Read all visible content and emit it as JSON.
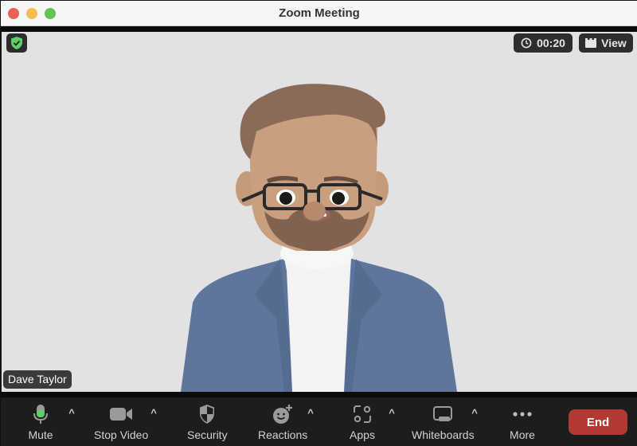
{
  "window": {
    "title": "Zoom Meeting"
  },
  "video": {
    "participant_name": "Dave Taylor",
    "timer": "00:20",
    "view_label": "View",
    "background_color": "#e2e2e5",
    "encryption_status": "secure"
  },
  "toolbar": {
    "items": [
      {
        "label": "Mute",
        "icon": "microphone-icon",
        "has_caret": true
      },
      {
        "label": "Stop Video",
        "icon": "video-camera-icon",
        "has_caret": true
      },
      {
        "label": "Security",
        "icon": "shield-icon",
        "has_caret": false
      },
      {
        "label": "Reactions",
        "icon": "smiley-plus-icon",
        "has_caret": true
      },
      {
        "label": "Apps",
        "icon": "apps-icon",
        "has_caret": true
      },
      {
        "label": "Whiteboards",
        "icon": "whiteboard-icon",
        "has_caret": true
      },
      {
        "label": "More",
        "icon": "more-dots-icon",
        "has_caret": false
      }
    ],
    "end_label": "End",
    "caret_glyph": "^"
  },
  "colors": {
    "end_button": "#b33a33",
    "mic_active": "#5fd068",
    "shield_green": "#5fd068",
    "toolbar_bg": "#1d1d1d"
  }
}
